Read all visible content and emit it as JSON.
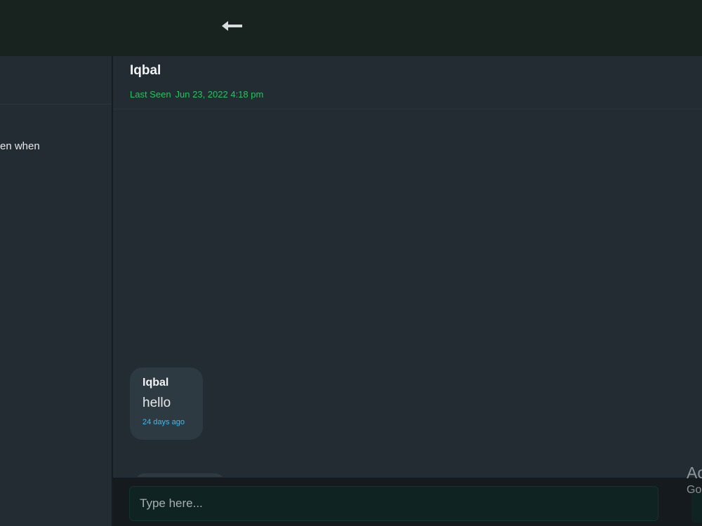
{
  "header": {
    "back_icon": "arrow-left-icon"
  },
  "sidebar": {
    "preview_snippet": "en when"
  },
  "chat": {
    "contact_name": "Iqbal",
    "last_seen_label": "Last Seen",
    "last_seen_time": "Jun 23, 2022 4:18 pm",
    "messages": [
      {
        "sender": "Iqbal",
        "text": "hello",
        "time": "24 days ago"
      }
    ]
  },
  "composer": {
    "placeholder": "Type here..."
  },
  "watermark": {
    "line1": "Ac",
    "line2": "Go"
  },
  "colors": {
    "topbar": "#18231f",
    "panel": "#232b33",
    "bubble": "#2d3a41",
    "last_seen_green": "#22c55e",
    "timestamp_blue": "#38bdf8",
    "input_bg": "#0f2422"
  }
}
